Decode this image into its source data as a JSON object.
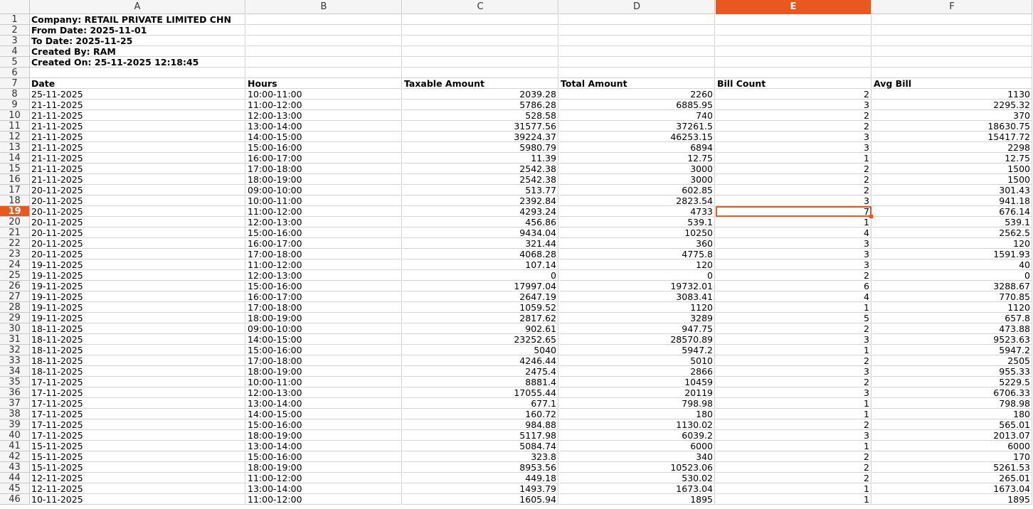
{
  "columns": [
    "A",
    "B",
    "C",
    "D",
    "E",
    "F"
  ],
  "active_column": "E",
  "active_row": 19,
  "header_block": [
    "Company: RETAIL PRIVATE LIMITED CHN",
    "From Date: 2025-11-01",
    "To Date: 2025-11-25",
    "Created By: RAM",
    "Created On: 25-11-2025 12:18:45"
  ],
  "table_headers": [
    "Date",
    "Hours",
    "Taxable Amount",
    "Total Amount",
    "Bill Count",
    "Avg Bill"
  ],
  "rows": [
    [
      "25-11-2025",
      "10:00-11:00",
      "2039.28",
      "2260",
      "2",
      "1130"
    ],
    [
      "21-11-2025",
      "11:00-12:00",
      "5786.28",
      "6885.95",
      "3",
      "2295.32"
    ],
    [
      "21-11-2025",
      "12:00-13:00",
      "528.58",
      "740",
      "2",
      "370"
    ],
    [
      "21-11-2025",
      "13:00-14:00",
      "31577.56",
      "37261.5",
      "2",
      "18630.75"
    ],
    [
      "21-11-2025",
      "14:00-15:00",
      "39224.37",
      "46253.15",
      "3",
      "15417.72"
    ],
    [
      "21-11-2025",
      "15:00-16:00",
      "5980.79",
      "6894",
      "3",
      "2298"
    ],
    [
      "21-11-2025",
      "16:00-17:00",
      "11.39",
      "12.75",
      "1",
      "12.75"
    ],
    [
      "21-11-2025",
      "17:00-18:00",
      "2542.38",
      "3000",
      "2",
      "1500"
    ],
    [
      "21-11-2025",
      "18:00-19:00",
      "2542.38",
      "3000",
      "2",
      "1500"
    ],
    [
      "20-11-2025",
      "09:00-10:00",
      "513.77",
      "602.85",
      "2",
      "301.43"
    ],
    [
      "20-11-2025",
      "10:00-11:00",
      "2392.84",
      "2823.54",
      "3",
      "941.18"
    ],
    [
      "20-11-2025",
      "11:00-12:00",
      "4293.24",
      "4733",
      "7",
      "676.14"
    ],
    [
      "20-11-2025",
      "12:00-13:00",
      "456.86",
      "539.1",
      "1",
      "539.1"
    ],
    [
      "20-11-2025",
      "15:00-16:00",
      "9434.04",
      "10250",
      "4",
      "2562.5"
    ],
    [
      "20-11-2025",
      "16:00-17:00",
      "321.44",
      "360",
      "3",
      "120"
    ],
    [
      "20-11-2025",
      "17:00-18:00",
      "4068.28",
      "4775.8",
      "3",
      "1591.93"
    ],
    [
      "19-11-2025",
      "11:00-12:00",
      "107.14",
      "120",
      "3",
      "40"
    ],
    [
      "19-11-2025",
      "12:00-13:00",
      "0",
      "0",
      "2",
      "0"
    ],
    [
      "19-11-2025",
      "15:00-16:00",
      "17997.04",
      "19732.01",
      "6",
      "3288.67"
    ],
    [
      "19-11-2025",
      "16:00-17:00",
      "2647.19",
      "3083.41",
      "4",
      "770.85"
    ],
    [
      "19-11-2025",
      "17:00-18:00",
      "1059.52",
      "1120",
      "1",
      "1120"
    ],
    [
      "19-11-2025",
      "18:00-19:00",
      "2817.62",
      "3289",
      "5",
      "657.8"
    ],
    [
      "18-11-2025",
      "09:00-10:00",
      "902.61",
      "947.75",
      "2",
      "473.88"
    ],
    [
      "18-11-2025",
      "14:00-15:00",
      "23252.65",
      "28570.89",
      "3",
      "9523.63"
    ],
    [
      "18-11-2025",
      "15:00-16:00",
      "5040",
      "5947.2",
      "1",
      "5947.2"
    ],
    [
      "18-11-2025",
      "17:00-18:00",
      "4246.44",
      "5010",
      "2",
      "2505"
    ],
    [
      "18-11-2025",
      "18:00-19:00",
      "2475.4",
      "2866",
      "3",
      "955.33"
    ],
    [
      "17-11-2025",
      "10:00-11:00",
      "8881.4",
      "10459",
      "2",
      "5229.5"
    ],
    [
      "17-11-2025",
      "12:00-13:00",
      "17055.44",
      "20119",
      "3",
      "6706.33"
    ],
    [
      "17-11-2025",
      "13:00-14:00",
      "677.1",
      "798.98",
      "1",
      "798.98"
    ],
    [
      "17-11-2025",
      "14:00-15:00",
      "160.72",
      "180",
      "1",
      "180"
    ],
    [
      "17-11-2025",
      "15:00-16:00",
      "984.88",
      "1130.02",
      "2",
      "565.01"
    ],
    [
      "17-11-2025",
      "18:00-19:00",
      "5117.98",
      "6039.2",
      "3",
      "2013.07"
    ],
    [
      "15-11-2025",
      "13:00-14:00",
      "5084.74",
      "6000",
      "1",
      "6000"
    ],
    [
      "15-11-2025",
      "15:00-16:00",
      "323.8",
      "340",
      "2",
      "170"
    ],
    [
      "15-11-2025",
      "18:00-19:00",
      "8953.56",
      "10523.06",
      "2",
      "5261.53"
    ],
    [
      "12-11-2025",
      "11:00-12:00",
      "449.18",
      "530.02",
      "2",
      "265.01"
    ],
    [
      "12-11-2025",
      "13:00-14:00",
      "1493.79",
      "1673.04",
      "1",
      "1673.04"
    ],
    [
      "10-11-2025",
      "11:00-12:00",
      "1605.94",
      "1895",
      "1",
      "1895"
    ]
  ],
  "colors": {
    "accent": "#e8581f",
    "header_bg": "#f5f5f5",
    "grid": "#d4d4d4"
  }
}
